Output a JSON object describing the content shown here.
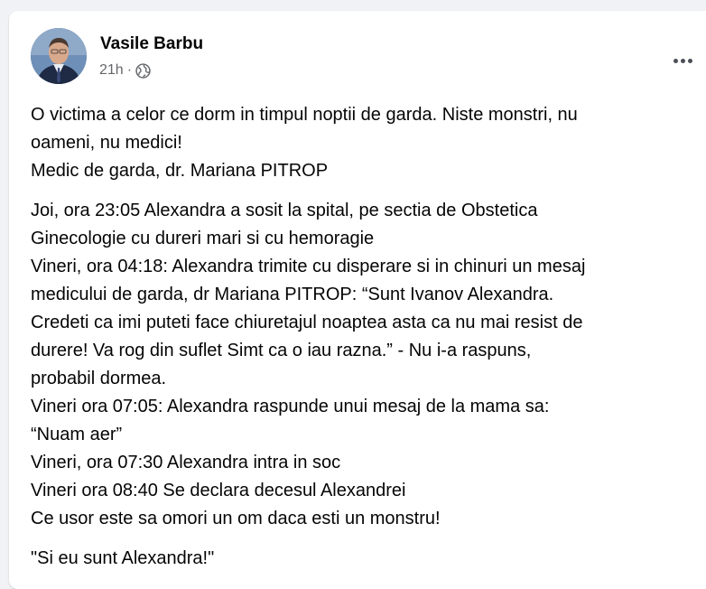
{
  "post": {
    "author": "Vasile Barbu",
    "time": "21h",
    "separator": "·",
    "privacy_icon": "globe-icon",
    "menu_icon": "more-options-icon",
    "paragraphs": [
      {
        "lines": [
          "O victima a celor ce dorm in timpul noptii de garda. Niste monstri, nu",
          "oameni, nu medici!",
          "Medic de garda, dr. Mariana PITROP"
        ]
      },
      {
        "lines": [
          "Joi, ora 23:05 Alexandra a sosit la spital, pe sectia de Obstetica",
          "Ginecologie cu dureri mari si cu hemoragie",
          "Vineri, ora 04:18: Alexandra trimite cu disperare si in chinuri un mesaj",
          "medicului de garda, dr Mariana PITROP: “Sunt Ivanov Alexandra.",
          "Credeti ca imi puteti face chiuretajul noaptea asta ca nu mai resist de",
          "durere! Va rog din suflet   Simt ca o iau razna.” - Nu i-a raspuns,",
          "probabil dormea.",
          "Vineri ora 07:05: Alexandra raspunde unui mesaj de la mama sa:",
          "“Nuam aer”",
          "Vineri, ora 07:30 Alexandra intra in soc",
          "Vineri ora 08:40 Se declara decesul Alexandrei",
          "Ce usor este sa omori un om daca esti un monstru!"
        ]
      },
      {
        "lines": [
          "\"Si eu sunt Alexandra!\""
        ]
      }
    ]
  },
  "colors": {
    "page_bg": "#f0f2f5",
    "card_bg": "#ffffff",
    "text_primary": "#050505",
    "text_secondary": "#65676b"
  }
}
